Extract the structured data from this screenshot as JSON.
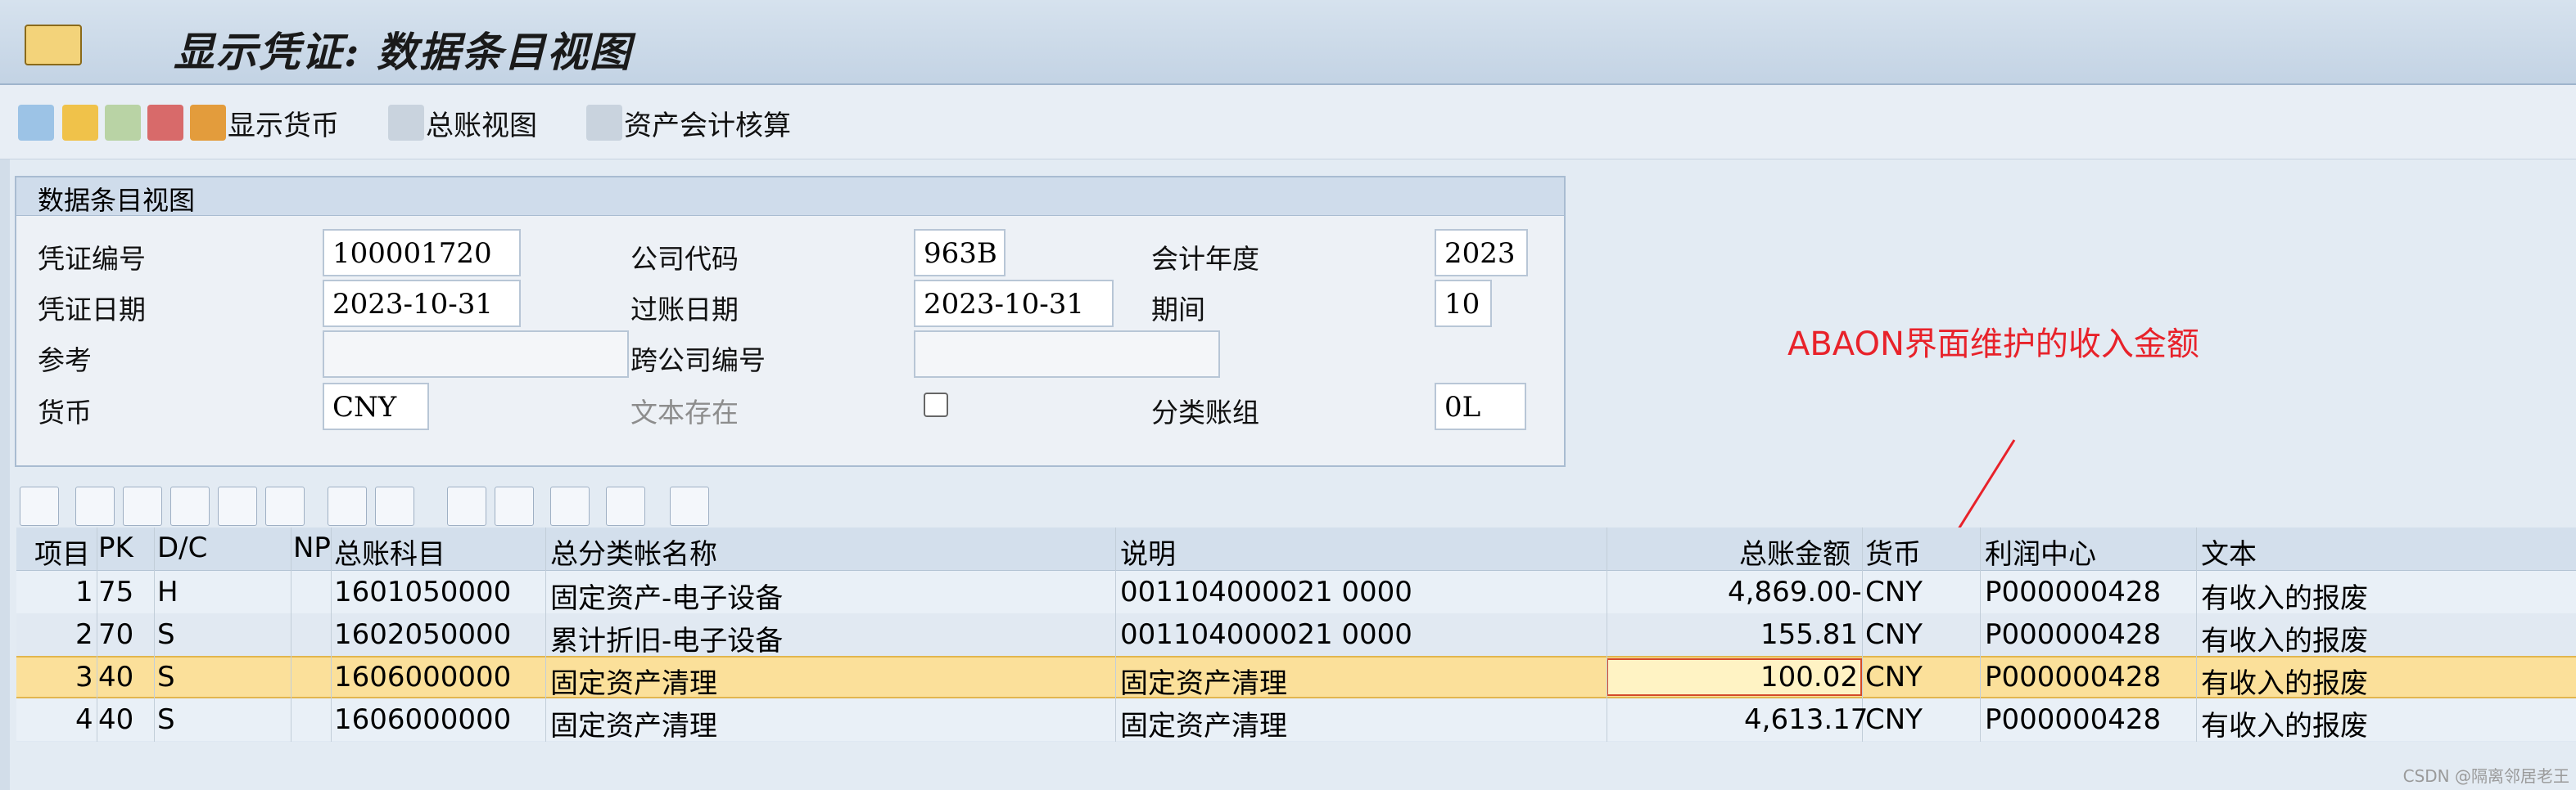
{
  "title": "显示凭证: 数据条目视图",
  "toolbar": {
    "display_currency": "显示货币",
    "general_ledger_view": "总账视图",
    "asset_accounting": "资产会计核算"
  },
  "header": {
    "group_title": "数据条目视图",
    "doc_no_label": "凭证编号",
    "doc_no": "100001720",
    "company_label": "公司代码",
    "company": "963B",
    "fiscal_year_label": "会计年度",
    "fiscal_year": "2023",
    "doc_date_label": "凭证日期",
    "doc_date": "2023-10-31",
    "posting_date_label": "过账日期",
    "posting_date": "2023-10-31",
    "period_label": "期间",
    "period": "10",
    "reference_label": "参考",
    "reference": "",
    "cross_company_label": "跨公司编号",
    "cross_company": "",
    "currency_label": "货币",
    "currency": "CNY",
    "text_exists_label": "文本存在",
    "ledger_group_label": "分类账组",
    "ledger_group": "0L"
  },
  "annotation": "ABAON界面维护的收入金额",
  "columns": [
    "项目",
    "PK",
    "D/C",
    "NP",
    "总账科目",
    "总分类帐名称",
    "说明",
    "总账金额",
    "货币",
    "利润中心",
    "文本"
  ],
  "rows": [
    {
      "item": "1",
      "pk": "75",
      "dc": "H",
      "account": "1601050000",
      "name": "固定资产-电子设备",
      "desc": "001104000021 0000",
      "amount": "4,869.00-",
      "currency": "CNY",
      "profit_center": "P000000428",
      "text": "有收入的报废"
    },
    {
      "item": "2",
      "pk": "70",
      "dc": "S",
      "account": "1602050000",
      "name": "累计折旧-电子设备",
      "desc": "001104000021 0000",
      "amount": "155.81",
      "currency": "CNY",
      "profit_center": "P000000428",
      "text": "有收入的报废"
    },
    {
      "item": "3",
      "pk": "40",
      "dc": "S",
      "account": "1606000000",
      "name": "固定资产清理",
      "desc": "固定资产清理",
      "amount": "100.02",
      "currency": "CNY",
      "profit_center": "P000000428",
      "text": "有收入的报废"
    },
    {
      "item": "4",
      "pk": "40",
      "dc": "S",
      "account": "1606000000",
      "name": "固定资产清理",
      "desc": "固定资产清理",
      "amount": "4,613.17",
      "currency": "CNY",
      "profit_center": "P000000428",
      "text": "有收入的报废"
    }
  ],
  "footer": "CSDN @隔离邻居老王",
  "colors": {
    "accent_red": "#e8222a",
    "selected_row": "#fbe09a",
    "selected_cell": "#fff3c4"
  }
}
